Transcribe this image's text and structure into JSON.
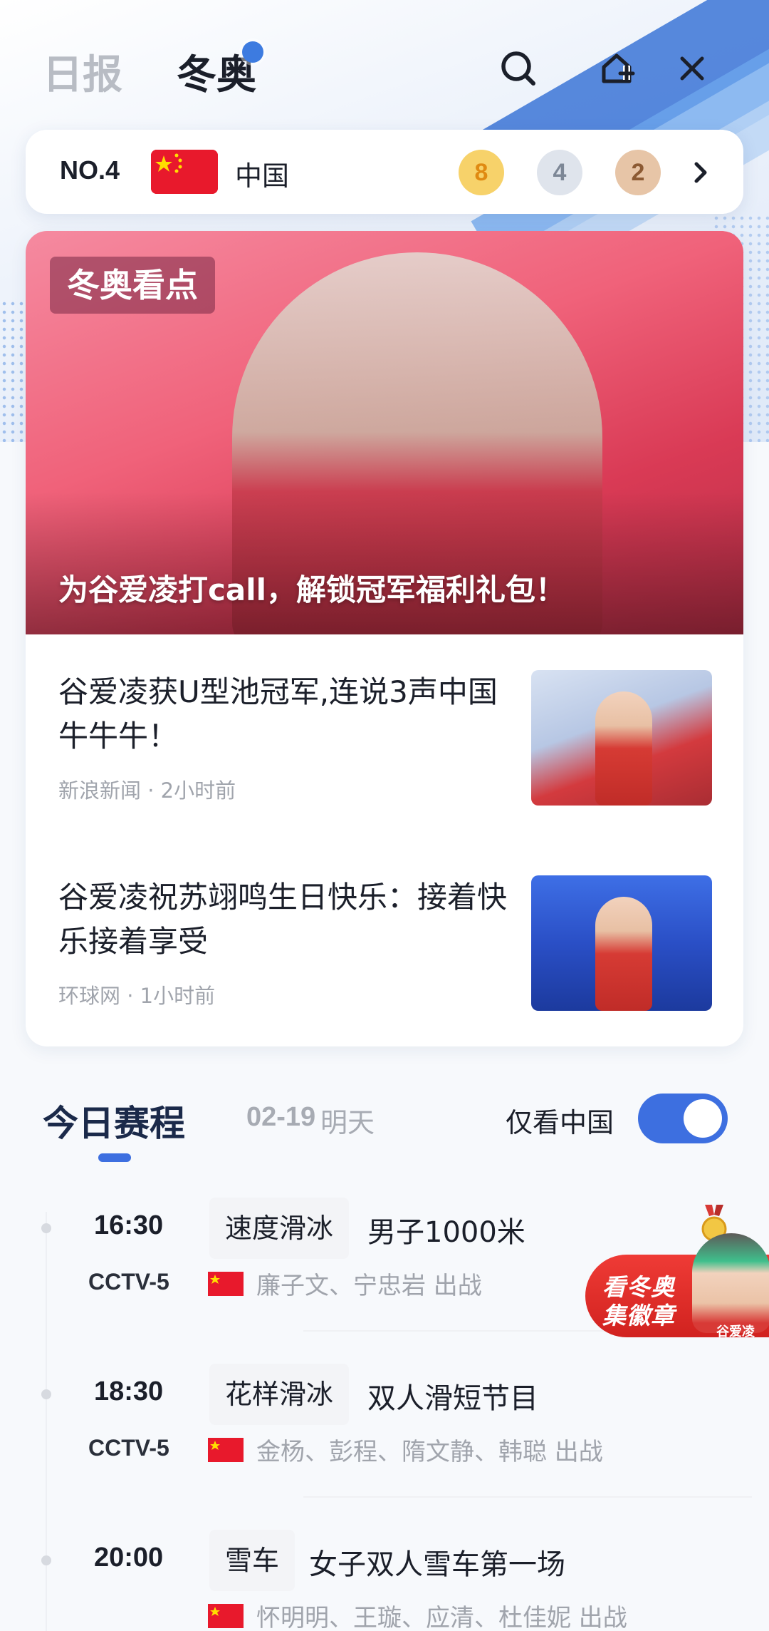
{
  "header": {
    "tab_daily": "日报",
    "tab_olympics": "冬奥",
    "icons": [
      "search-icon",
      "add-to-home-icon",
      "close-icon"
    ]
  },
  "medal_bar": {
    "rank": "NO.4",
    "country": "中国",
    "gold": "8",
    "silver": "4",
    "bronze": "2",
    "colors": {
      "gold": "#f7d26a",
      "silver": "#dfe4ec",
      "bronze": "#e7c5a7",
      "flag": "#e8192c"
    }
  },
  "hero": {
    "tag": "冬奥看点",
    "caption": "为谷爱凌打call，解锁冠军福利礼包！"
  },
  "articles": [
    {
      "title": "谷爱凌获U型池冠军,连说3声中国牛牛牛！",
      "meta": "新浪新闻 · 2小时前"
    },
    {
      "title": "谷爱凌祝苏翊鸣生日快乐：接着快乐接着享受",
      "meta": "环球网 · 1小时前"
    }
  ],
  "schedule": {
    "title": "今日赛程",
    "date": "02-19",
    "date_label": "明天",
    "filter_label": "仅看中国",
    "filter_on": true,
    "accent": "#3d6fe0",
    "events": [
      {
        "time": "16:30",
        "sport": "速度滑冰",
        "name": "男子1000米",
        "channel": "CCTV-5",
        "athletes": "廉子文、宁忠岩 出战"
      },
      {
        "time": "18:30",
        "sport": "花样滑冰",
        "name": "双人滑短节目",
        "channel": "CCTV-5",
        "athletes": "金杨、彭程、隋文静、韩聪 出战"
      },
      {
        "time": "20:00",
        "sport": "雪车",
        "name": "女子双人雪车第一场",
        "channel": "",
        "athletes": "怀明明、王璇、应清、杜佳妮 出战"
      }
    ]
  },
  "badge": {
    "line1": "看冬奥",
    "line2": "集徽章",
    "name": "谷爱凌"
  }
}
